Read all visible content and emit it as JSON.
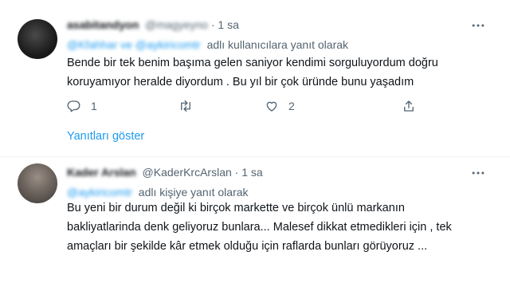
{
  "tweet1": {
    "display_name": "asabitandyon",
    "handle": "@magyeyno",
    "time": "1 sa",
    "reply_prefix": "@Kfahhar ve @aykiricomtr",
    "reply_suffix": "adlı kullanıcılara yanıt olarak",
    "lines": [
      "Bende bir tek benim başıma gelen  saniyor  kendimi  sorguluyordum  doğru",
      "koruyamıyor heralde  diyordum   .  Bu yıl bir çok üründe  bunu yaşadım"
    ],
    "reply_count": "1",
    "retweet_count": "",
    "like_count": "2"
  },
  "show_replies": "Yanıtları göster",
  "tweet2": {
    "display_name": "Kader Arslan",
    "handle": "@KaderKrcArslan",
    "time": "1 sa",
    "reply_prefix": "@aykiricomtr",
    "reply_suffix": "adlı kişiye yanıt olarak",
    "lines": [
      "Bu yeni bir durum değil ki birçok markette ve birçok ünlü markanın",
      "bakliyatlarinda denk geliyoruz bunlara... Malesef dikkat etmedikleri için , tek",
      "amaçları bir şekilde kâr etmek olduğu için raflarda bunları görüyoruz ..."
    ]
  },
  "icons": {
    "more": "more-horizontal-icon",
    "reply": "reply-icon",
    "retweet": "retweet-icon",
    "like": "heart-icon",
    "share": "share-icon"
  },
  "colors": {
    "accent": "#1d9bf0",
    "muted": "#536471",
    "text": "#0f1419",
    "divider": "#eff3f4"
  }
}
